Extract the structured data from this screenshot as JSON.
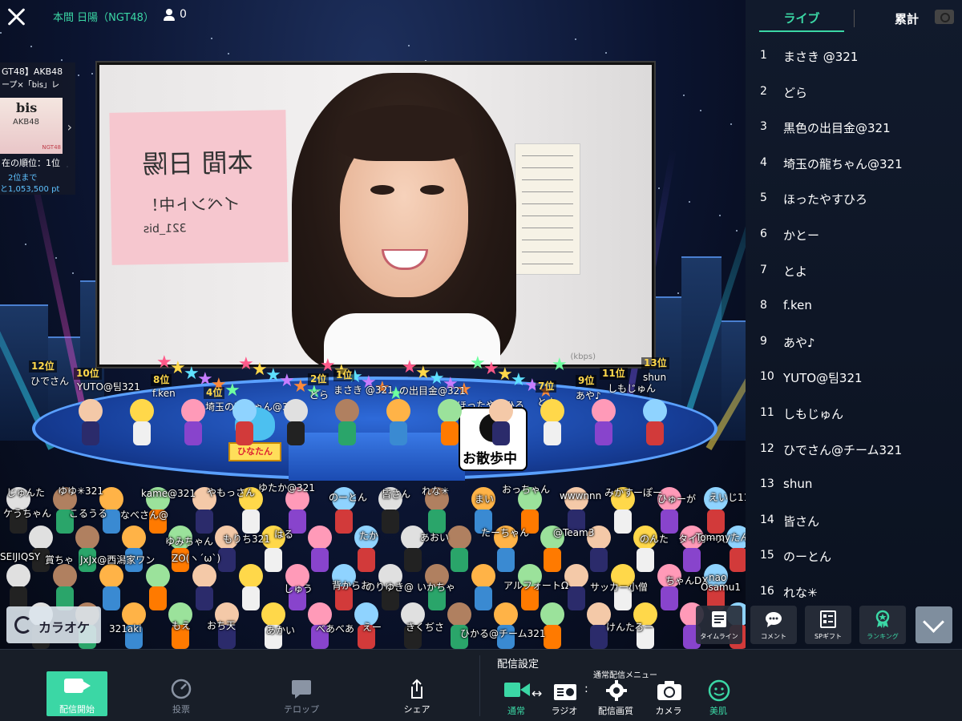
{
  "header": {
    "room_title": "本間 日陽（NGT48）",
    "viewer_count": "0"
  },
  "banner": {
    "line1": "GT48】AKB48",
    "line2": "ープ×「bis」レ",
    "brand": "bis",
    "thumb_sub": "AKB48",
    "thumb_tag": "NGT48",
    "rank_text": "在の順位：1位",
    "next_text": "2位まで",
    "gap_text": "と1,053,500 pt"
  },
  "video": {
    "handwriting_1": "本間 日陽",
    "handwriting_2": "イベント中！",
    "handwriting_3": "321_bis",
    "bitrate": "(kbps)"
  },
  "stage": {
    "rank_tags": [
      "12位",
      "10位",
      "8位",
      "4位",
      "2位",
      "1位",
      "7位",
      "9位",
      "11位",
      "13位"
    ],
    "name_tags": [
      "ひでさん",
      "YUTO@팀321",
      "f.ken",
      "埼玉の龍ちゃん@32",
      "どら",
      "まさき @321",
      "の出目金@321",
      "ほったやすひろ",
      "とよ",
      "あや♪",
      "しもじゅん",
      "shun"
    ],
    "sign_sanpo": "お散歩中",
    "sign_hina": "ひなたん"
  },
  "crowd_names": [
    "じゅんた",
    "ゆゆ✳321",
    "kame@321",
    "やもっさん",
    "ゆたか@321",
    "のーとん",
    "皆さん",
    "れな✳",
    "まい",
    "おっちゃん",
    "wwwnnn",
    "みかすーぽー",
    "ひゅーが",
    "えいじ113",
    "ケうちゃん",
    "こるうる",
    "なべさん@",
    "はる",
    "たか",
    "あおい",
    "たーちゃん",
    "@Team3",
    "のんた",
    "タイガース",
    "ゆみちゃん",
    "もりち321",
    "Tommyたん(とみ",
    "SEIJIQSY",
    "賞ちゃ",
    "JxJx@西潟家ワン",
    "ZO(ヽ´ω`)",
    "しゅう",
    "背からお",
    "のりゆき@",
    "いかちゃ",
    "アルフォートΩ",
    "サッカー小僧",
    "ちゃんDX",
    "Osamu1",
    "321aki",
    "もえ",
    "おち天",
    "あかい",
    "べあべあ",
    "えー",
    "きくぢさ",
    "ひかる@チーム321",
    "けんたろー",
    "nao"
  ],
  "karaoke": {
    "label": "カラオケ"
  },
  "actions": {
    "timeline": "タイムライン",
    "comment": "コメント",
    "sp_gift": "SPギフト",
    "ranking": "ランキング"
  },
  "panel": {
    "tab_live": "ライブ",
    "tab_total": "累計",
    "ranking": [
      {
        "rank": "1",
        "name": "まさき @321"
      },
      {
        "rank": "2",
        "name": "どら"
      },
      {
        "rank": "3",
        "name": "黒色の出目金@321"
      },
      {
        "rank": "4",
        "name": "埼玉の龍ちゃん@321"
      },
      {
        "rank": "5",
        "name": "ほったやすひろ"
      },
      {
        "rank": "6",
        "name": "かとー"
      },
      {
        "rank": "7",
        "name": "とよ"
      },
      {
        "rank": "8",
        "name": "f.ken"
      },
      {
        "rank": "9",
        "name": "あや♪"
      },
      {
        "rank": "10",
        "name": "YUTO@팀321"
      },
      {
        "rank": "11",
        "name": "しもじゅん"
      },
      {
        "rank": "12",
        "name": "ひでさん@チーム321"
      },
      {
        "rank": "13",
        "name": "shun"
      },
      {
        "rank": "14",
        "name": "皆さん"
      },
      {
        "rank": "15",
        "name": "のーとん"
      },
      {
        "rank": "16",
        "name": "れな✳"
      }
    ]
  },
  "bottom": {
    "start": "配信開始",
    "vote": "投票",
    "telop": "テロップ",
    "share": "シェア",
    "settings_title": "配信設定",
    "menu_caption": "通常配信メニュー",
    "normal": "通常",
    "radio": "ラジオ",
    "quality": "配信画質",
    "camera": "カメラ",
    "beauty": "美肌"
  },
  "colors": {
    "accent": "#3bd7a5",
    "rank_gold": "#ffd84a",
    "stage_blue": "#2e6ad9"
  }
}
